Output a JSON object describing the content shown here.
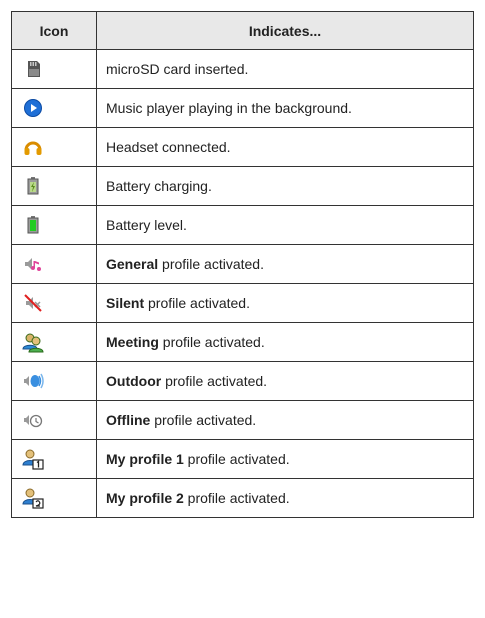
{
  "header": {
    "icon": "Icon",
    "indicates": "Indicates..."
  },
  "rows": [
    {
      "icon": "microsd-card-icon",
      "bold": "",
      "text": "microSD card inserted."
    },
    {
      "icon": "music-play-icon",
      "bold": "",
      "text": "Music player playing in the background."
    },
    {
      "icon": "headset-icon",
      "bold": "",
      "text": "Headset connected."
    },
    {
      "icon": "battery-charging-icon",
      "bold": "",
      "text": "Battery charging."
    },
    {
      "icon": "battery-level-icon",
      "bold": "",
      "text": "Battery level."
    },
    {
      "icon": "general-profile-icon",
      "bold": "General",
      "text": " profile activated."
    },
    {
      "icon": "silent-profile-icon",
      "bold": "Silent",
      "text": " profile activated."
    },
    {
      "icon": "meeting-profile-icon",
      "bold": "Meeting",
      "text": " profile activated."
    },
    {
      "icon": "outdoor-profile-icon",
      "bold": "Outdoor",
      "text": " profile activated."
    },
    {
      "icon": "offline-profile-icon",
      "bold": "Offline",
      "text": " profile activated."
    },
    {
      "icon": "my-profile-1-icon",
      "bold": "My profile 1",
      "text": " profile activated."
    },
    {
      "icon": "my-profile-2-icon",
      "bold": "My profile 2",
      "text": " profile activated."
    }
  ]
}
